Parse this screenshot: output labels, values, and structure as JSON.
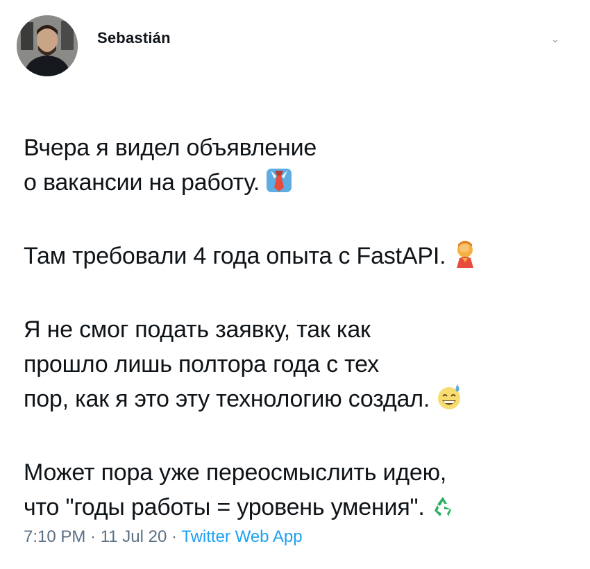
{
  "author": {
    "name": "Sebastián"
  },
  "tweet": {
    "paragraphs": [
      [
        "Вчера я видел объявление",
        "о вакансии на работу."
      ],
      [
        "Там требовали 4 года опыта с FastAPI."
      ],
      [
        "Я не смог подать заявку, так как",
        "прошло лишь полтора года с тех",
        "пор, как я это эту технологию создал."
      ],
      [
        "Может пора уже переосмыслить идею,",
        "что \"годы работы = уровень умения\"."
      ]
    ],
    "emojis": [
      "necktie-icon",
      "facepalm-icon",
      "sweat-smile-icon",
      "recycle-icon"
    ]
  },
  "meta": {
    "time": "7:10 PM",
    "separator": " · ",
    "date": "11 Jul 20",
    "source": "Twitter Web App"
  }
}
